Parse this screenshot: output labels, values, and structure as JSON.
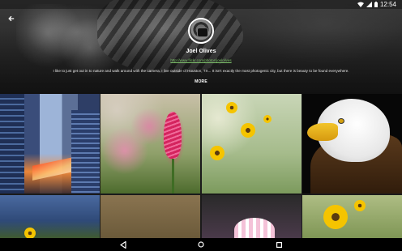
{
  "status_bar": {
    "time": "12:54",
    "icons": [
      "wifi-icon",
      "signal-icon",
      "battery-icon"
    ]
  },
  "header": {
    "back_icon": "arrow-back-icon",
    "profile": {
      "name": "Joel Olives",
      "url": "http://www.flickr.com/photos/joelolives",
      "bio": "I like to just get out in to nature and walk around with the camera. I live outside of Houston, TX... It isn't exactly the most photogenic city, but there is beauty to be found everywhere.",
      "more_label": "MORE"
    }
  },
  "photos": [
    {
      "subject": "city-night-traffic"
    },
    {
      "subject": "pink-clover-flower"
    },
    {
      "subject": "yellow-wildflowers"
    },
    {
      "subject": "bald-eagle"
    },
    {
      "subject": "blue-sky-flowers"
    },
    {
      "subject": "brown-field"
    },
    {
      "subject": "pink-flower"
    },
    {
      "subject": "yellow-flower-green"
    }
  ],
  "nav_bar": {
    "back": "nav-back-icon",
    "home": "nav-home-icon",
    "recents": "nav-recents-icon"
  },
  "colors": {
    "link": "#7ec26b",
    "nav_background": "#000000"
  }
}
